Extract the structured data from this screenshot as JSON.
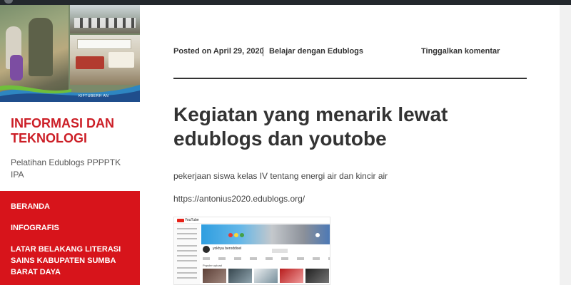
{
  "sidebar": {
    "header_caption": "KIFTUBERH AN",
    "site_title": "INFORMASI DAN TEKNOLOGI",
    "site_description": "Pelatihan Edublogs PPPPTK IPA",
    "nav": [
      {
        "label": "BERANDA"
      },
      {
        "label": "INFOGRAFIS"
      },
      {
        "label": "LATAR BELAKANG LITERASI SAINS KABUPATEN SUMBA BARAT DAYA"
      }
    ]
  },
  "post": {
    "posted_on": "Posted on April 29, 2020",
    "category": "Belajar dengan Edublogs",
    "comment_link": "Tinggalkan komentar",
    "title": "Kegiatan yang menarik lewat edublogs dan youtobe",
    "text": "pekerjaan siswa kelas IV tentang energi air dan kincir air",
    "link": "https://antonius2020.edublogs.org/"
  },
  "thumbnail": {
    "logo_text": "YouTube",
    "channel_name": "yokhya beroddisel",
    "section_label": "Populer upload"
  },
  "colors": {
    "accent_red": "#d7141b",
    "title_red": "#cc1e26",
    "text_dark": "#333333"
  }
}
